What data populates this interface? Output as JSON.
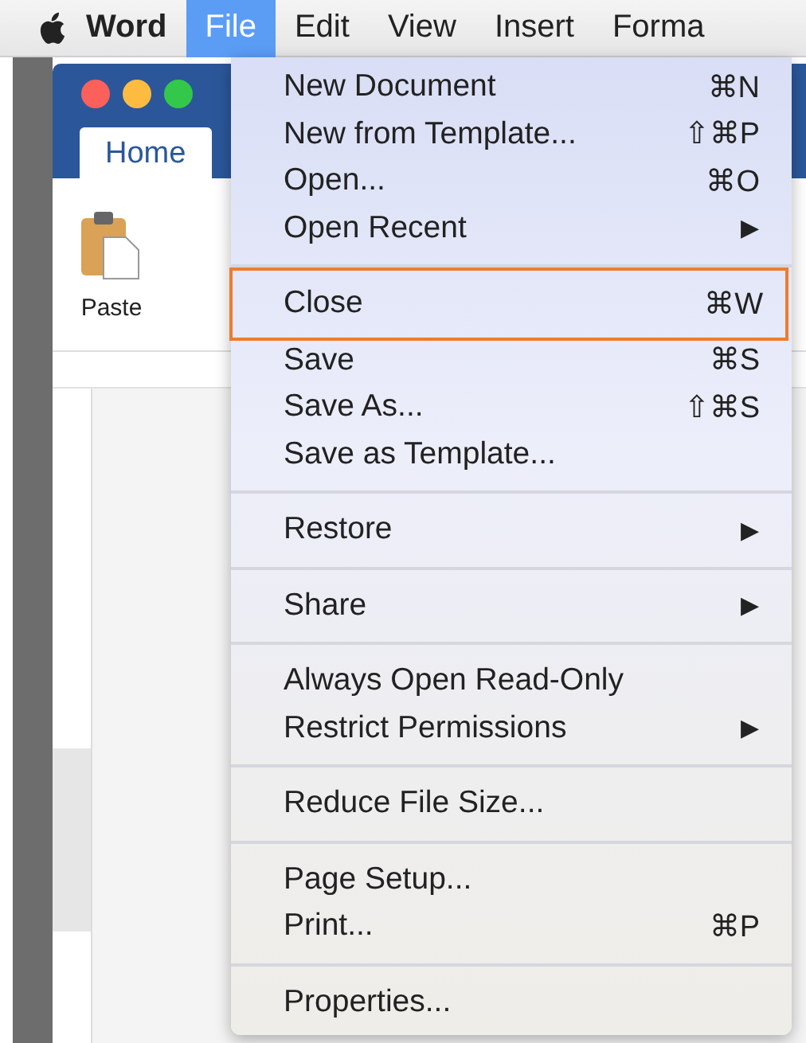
{
  "menu_bar": {
    "items": [
      {
        "label": "Word",
        "selected": false,
        "bold": true
      },
      {
        "label": "File",
        "selected": true,
        "bold": false
      },
      {
        "label": "Edit",
        "selected": false,
        "bold": false
      },
      {
        "label": "View",
        "selected": false,
        "bold": false
      },
      {
        "label": "Insert",
        "selected": false,
        "bold": false
      },
      {
        "label": "Forma",
        "selected": false,
        "bold": false
      }
    ]
  },
  "window": {
    "tabs": [
      {
        "label": "Home",
        "selected": true
      }
    ],
    "ribbon": {
      "paste_label": "Paste"
    }
  },
  "file_menu": {
    "groups": [
      [
        {
          "label": "New Document",
          "shortcut": "⌘N",
          "highlighted": false
        },
        {
          "label": "New from Template...",
          "shortcut": "⇧⌘P",
          "highlighted": false
        },
        {
          "label": "Open...",
          "shortcut": "⌘O",
          "highlighted": false
        },
        {
          "label": "Open Recent",
          "arrow": "▶",
          "highlighted": false
        }
      ],
      [
        {
          "label": "Close",
          "shortcut": "⌘W",
          "highlighted": true
        },
        {
          "label": "Save",
          "shortcut": "⌘S",
          "highlighted": false
        },
        {
          "label": "Save As...",
          "shortcut": "⇧⌘S",
          "highlighted": false
        },
        {
          "label": "Save as Template...",
          "highlighted": false
        }
      ],
      [
        {
          "label": "Restore",
          "arrow": "▶",
          "highlighted": false
        }
      ],
      [
        {
          "label": "Share",
          "arrow": "▶",
          "highlighted": false
        }
      ],
      [
        {
          "label": "Always Open Read-Only",
          "highlighted": false
        },
        {
          "label": "Restrict Permissions",
          "arrow": "▶",
          "highlighted": false
        }
      ],
      [
        {
          "label": "Reduce File Size...",
          "highlighted": false
        }
      ],
      [
        {
          "label": "Page Setup...",
          "highlighted": false
        },
        {
          "label": "Print...",
          "shortcut": "⌘P",
          "highlighted": false
        }
      ],
      [
        {
          "label": "Properties...",
          "highlighted": false
        }
      ]
    ]
  }
}
